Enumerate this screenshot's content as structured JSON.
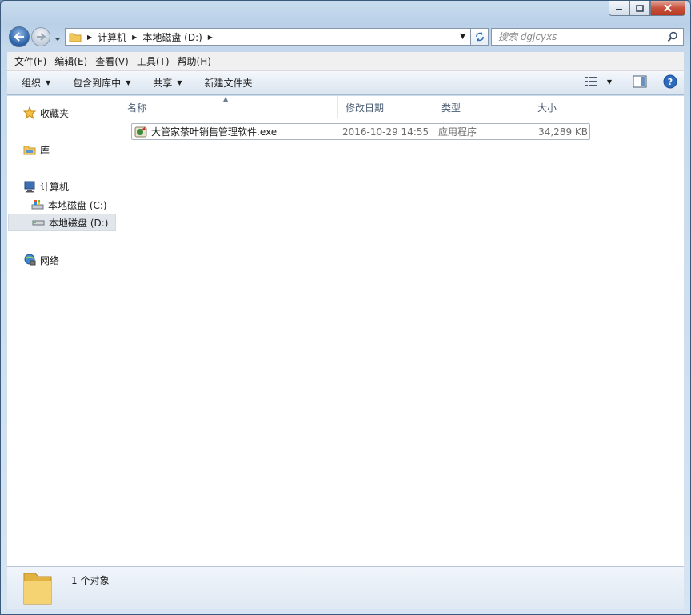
{
  "window": {
    "caption": {
      "minimize": "—",
      "maximize": "□",
      "close": "✕"
    }
  },
  "address": {
    "crumbs": [
      "计算机",
      "本地磁盘 (D:)"
    ],
    "search_placeholder": "搜索 dgjcyxs"
  },
  "menu": {
    "items": [
      "文件(F)",
      "编辑(E)",
      "查看(V)",
      "工具(T)",
      "帮助(H)"
    ]
  },
  "toolbar": {
    "organize": "组织",
    "include_in_library": "包含到库中",
    "share": "共享",
    "new_folder": "新建文件夹"
  },
  "nav": {
    "favorites": "收藏夹",
    "libraries": "库",
    "computer": "计算机",
    "drive_c": "本地磁盘 (C:)",
    "drive_d": "本地磁盘 (D:)",
    "network": "网络"
  },
  "columns": {
    "name": "名称",
    "modified": "修改日期",
    "type": "类型",
    "size": "大小"
  },
  "files": [
    {
      "name": "大管家茶叶销售管理软件.exe",
      "modified": "2016-10-29 14:55",
      "type": "应用程序",
      "size": "34,289 KB"
    }
  ],
  "status": {
    "count": "1 个对象"
  }
}
